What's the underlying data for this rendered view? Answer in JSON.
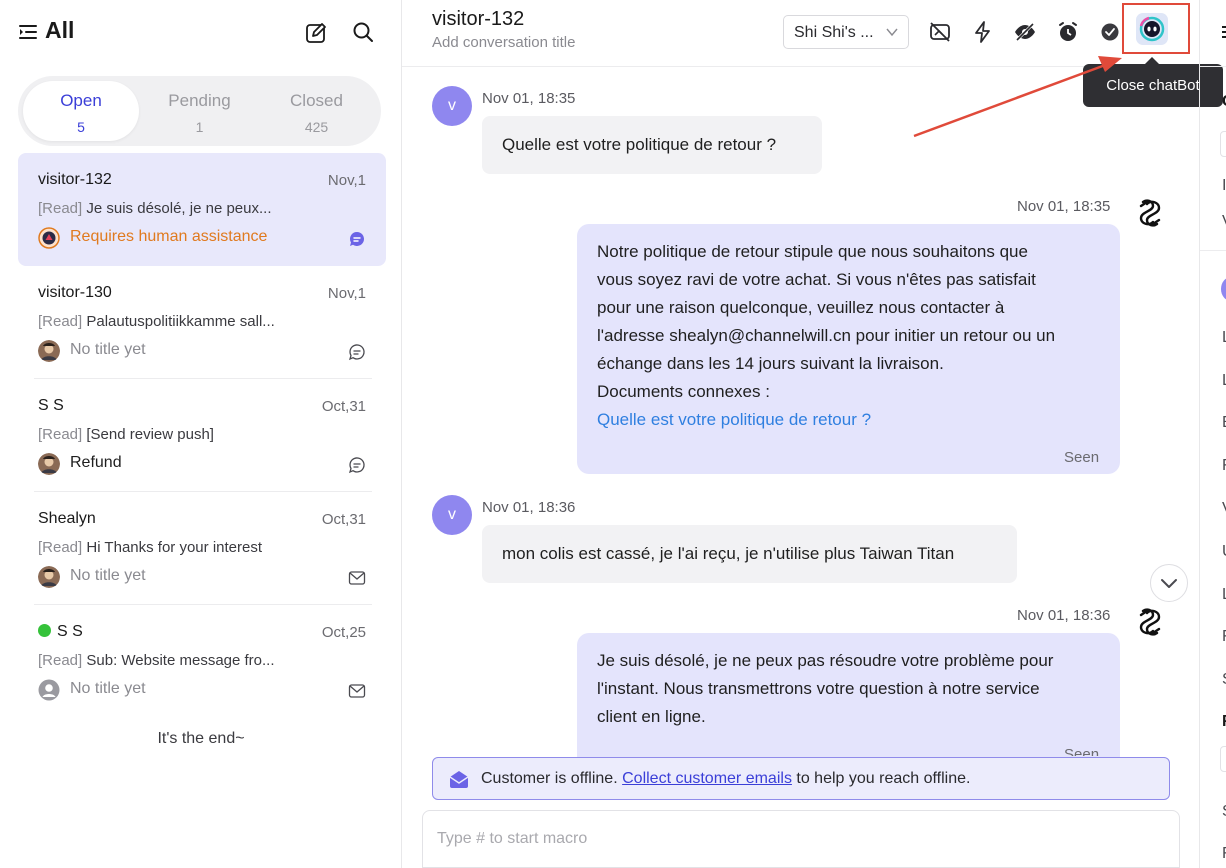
{
  "sidebar": {
    "title": "All",
    "tabs": [
      {
        "label": "Open",
        "count": "5"
      },
      {
        "label": "Pending",
        "count": "1"
      },
      {
        "label": "Closed",
        "count": "425"
      }
    ],
    "conversations": [
      {
        "name": "visitor-132",
        "date": "Nov,1",
        "tag": "[Read]",
        "preview": "Je suis désolé, je ne peux...",
        "subtext": "Requires human assistance"
      },
      {
        "name": "visitor-130",
        "date": "Nov,1",
        "tag": "[Read]",
        "preview": "Palautuspolitiikkamme sall...",
        "subtext": "No title yet"
      },
      {
        "name": "S S",
        "date": "Oct,31",
        "tag": "[Read]",
        "preview": "[Send review push]",
        "subtext": "Refund"
      },
      {
        "name": "Shealyn",
        "date": "Oct,31",
        "tag": "[Read]",
        "preview": "Hi Thanks for your interest",
        "subtext": "No title yet"
      },
      {
        "name": "S S",
        "date": "Oct,25",
        "tag": "[Read]",
        "preview": "Sub: Website message fro...",
        "subtext": "No title yet"
      }
    ],
    "end_text": "It's the end~"
  },
  "chat": {
    "title": "visitor-132",
    "subtitle": "Add conversation title",
    "agent": "Shi Shi's ...",
    "tooltip": "Close chatBot",
    "messages": [
      {
        "time": "Nov 01, 18:35",
        "avatar": "v",
        "text": "Quelle est votre politique de retour ?"
      },
      {
        "time": "Nov 01, 18:35",
        "lines": [
          "Notre politique de retour stipule que nous souhaitons que",
          "vous soyez ravi de votre achat. Si vous n'êtes pas satisfait",
          "pour une raison quelconque, veuillez nous contacter à",
          "l'adresse shealyn@channelwill.cn pour initier un retour ou un",
          "échange dans les 14 jours suivant la livraison.",
          "Documents connexes :"
        ],
        "link": "Quelle est votre politique de retour ?",
        "status": "Seen"
      },
      {
        "time": "Nov 01, 18:36",
        "avatar": "v",
        "text": "mon colis est cassé, je l'ai reçu, je n'utilise plus Taiwan Titan"
      },
      {
        "time": "Nov 01, 18:36",
        "lines": [
          "Je suis désolé, je ne peux pas résoudre votre problème pour",
          "l'instant. Nous transmettrons votre question à notre service",
          "client en ligne."
        ],
        "status": "Seen"
      }
    ],
    "offline_prefix": "Customer is offline.",
    "offline_link": "Collect customer emails",
    "offline_suffix": "to help you reach offline.",
    "composer_placeholder": "Type # to start macro"
  },
  "right_panel_letters": [
    "I",
    "V",
    "L",
    "L",
    "E",
    "F",
    "V",
    "U",
    "L",
    "F",
    "S",
    "F",
    "S",
    "F"
  ],
  "colors": {
    "accent": "#3b3fd8",
    "alert": "#e07a1f",
    "bubble_out": "#e4e4fc",
    "highlight": "#e04a3a"
  }
}
